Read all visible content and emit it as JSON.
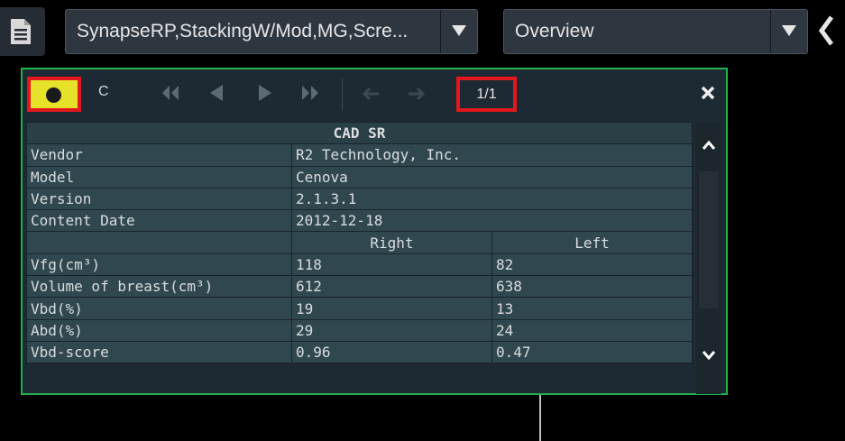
{
  "toolbar": {
    "layout_select": "SynapseRP,StackingW/Mod,MG,Scre...",
    "view_select": "Overview"
  },
  "panel": {
    "mode_label": "C",
    "page_indicator": "1/1"
  },
  "table": {
    "title": "CAD SR",
    "info_rows": [
      {
        "label": "Vendor",
        "value": "R2 Technology, Inc."
      },
      {
        "label": "Model",
        "value": "Cenova"
      },
      {
        "label": "Version",
        "value": "2.1.3.1"
      },
      {
        "label": "Content Date",
        "value": "2012-12-18"
      }
    ],
    "columns": [
      "",
      "Right",
      "Left"
    ],
    "measure_rows": [
      [
        "Vfg(cm³)",
        "118",
        "82"
      ],
      [
        "Volume of breast(cm³)",
        "612",
        "638"
      ],
      [
        "Vbd(%)",
        "19",
        "13"
      ],
      [
        "Abd(%)",
        "29",
        "24"
      ],
      [
        "Vbd-score",
        "0.96",
        "0.47"
      ]
    ]
  },
  "icons": [
    "document-icon",
    "chevron-down-icon",
    "chevron-left-icon",
    "record-icon",
    "first-page-icon",
    "prev-page-icon",
    "next-page-icon",
    "last-page-icon",
    "back-arrow-icon",
    "forward-arrow-icon",
    "close-icon",
    "scroll-up-icon",
    "scroll-down-icon"
  ],
  "colors": {
    "panel_border": "#22b24c",
    "highlight_box": "#e3171e",
    "record_button": "#e6e229",
    "table_cell": "#31474f"
  }
}
